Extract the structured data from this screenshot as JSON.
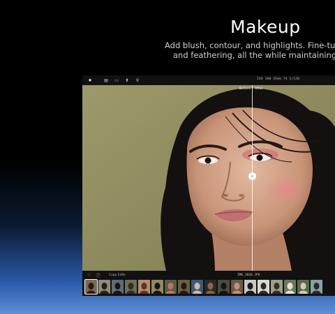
{
  "hero": {
    "title": "Makeup",
    "subtitle_line1": "Add blush, contour, and highlights. Fine-tune",
    "subtitle_line2": "and feathering, all the while maintaining a"
  },
  "app": {
    "toolbar": {
      "icons": [
        "sun-icon",
        "gallery-icon",
        "chat-icon",
        "share-icon",
        "search-icon"
      ],
      "exif": "ISO 100   35mm   f4   1/120"
    },
    "compare": {
      "before_label": "Before",
      "after_label": "After",
      "split_position": 0.67
    },
    "bottom": {
      "copy_edits_label": "Copy Edits",
      "filename": "IMG_1826.JPG",
      "thumbnails": [
        {
          "bg": "#7a6a55",
          "fg": "#2a1a12"
        },
        {
          "bg": "#8a8f7a",
          "fg": "#2a1e18"
        },
        {
          "bg": "#5d6e7a",
          "fg": "#1c1410"
        },
        {
          "bg": "#6a6f58",
          "fg": "#3a2a1e"
        },
        {
          "bg": "#b88c70",
          "fg": "#5a3424"
        },
        {
          "bg": "#8f8c5e",
          "fg": "#1a1512"
        },
        {
          "bg": "#5a5a48",
          "fg": "#b07a60"
        },
        {
          "bg": "#6a5f3e",
          "fg": "#1e1a14"
        },
        {
          "bg": "#3a5a7a",
          "fg": "#d8b8a0"
        },
        {
          "bg": "#2a2a24",
          "fg": "#8a6450"
        },
        {
          "bg": "#4a4a40",
          "fg": "#1a1410"
        },
        {
          "bg": "#6a5a48",
          "fg": "#c09078"
        },
        {
          "bg": "#c8c8c4",
          "fg": "#1a1a1a"
        },
        {
          "bg": "#d8d8d4",
          "fg": "#2a2a2a"
        },
        {
          "bg": "#9aa08a",
          "fg": "#3a2e24"
        },
        {
          "bg": "#6a7a5a",
          "fg": "#e8e0d8"
        },
        {
          "bg": "#5a6a48",
          "fg": "#d0c8c0"
        },
        {
          "bg": "#8aa0a8",
          "fg": "#2a2a28"
        }
      ]
    }
  }
}
